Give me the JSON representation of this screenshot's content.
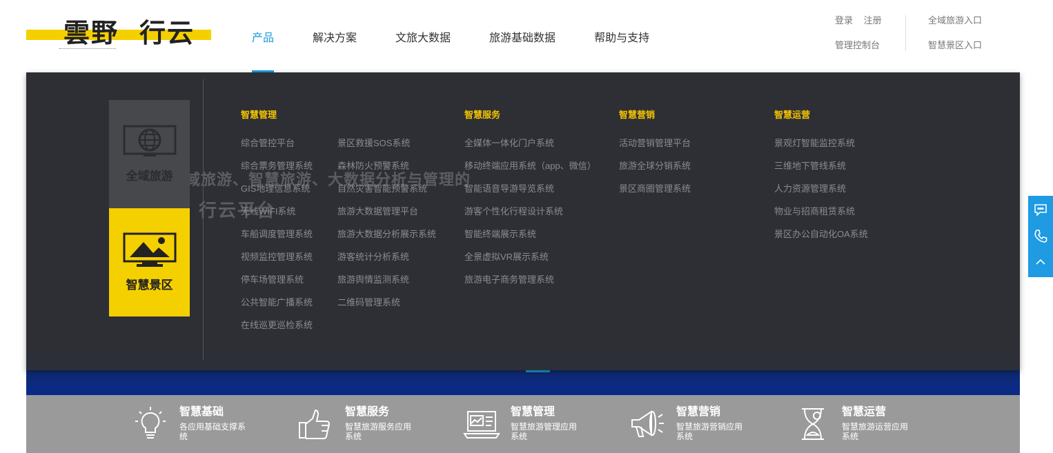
{
  "logo": {
    "char_a": "雲野",
    "char_b": "行云"
  },
  "nav": {
    "items": [
      {
        "label": "产品",
        "active": true
      },
      {
        "label": "解决方案"
      },
      {
        "label": "文旅大数据"
      },
      {
        "label": "旅游基础数据"
      },
      {
        "label": "帮助与支持"
      }
    ]
  },
  "user_links": {
    "login": "登录",
    "register": "注册",
    "console": "管理控制台"
  },
  "entry_links": {
    "region": "全域旅游入口",
    "scenic": "智慧景区入口"
  },
  "banner": {
    "bg_line1": "域旅游、智慧旅游、大数据分析与管理的",
    "bg_line2": "行云平台"
  },
  "side_tabs": [
    {
      "label": "全域旅游",
      "icon": "globe-monitor-icon"
    },
    {
      "label": "智慧景区",
      "icon": "landscape-monitor-icon",
      "active": true
    }
  ],
  "columns": {
    "management": {
      "title": "智慧管理",
      "left": [
        "综合管控平台",
        "综合票务管理系统",
        "GIS地理信息系统",
        "无线WIFI系统",
        "车船调度管理系统",
        "视频监控管理系统",
        "停车场管理系统",
        "公共智能广播系统",
        "在线巡更巡检系统"
      ],
      "right": [
        "景区救援SOS系统",
        "森林防火预警系统",
        "自然灾害智能预警系统",
        "旅游大数据管理平台",
        "旅游大数据分析展示系统",
        "游客统计分析系统",
        "旅游舆情监测系统",
        "二维码管理系统"
      ]
    },
    "service": {
      "title": "智慧服务",
      "items": [
        "全媒体一体化门户系统",
        "移动终端应用系统（app、微信）",
        "智能语音导游导览系统",
        "游客个性化行程设计系统",
        "智能终端展示系统",
        "全景虚拟VR展示系统",
        "旅游电子商务管理系统"
      ]
    },
    "marketing": {
      "title": "智慧营销",
      "items": [
        "活动营销管理平台",
        "旅游全球分销系统",
        "景区商圈管理系统"
      ]
    },
    "operation": {
      "title": "智慧运营",
      "items": [
        "景观灯智能监控系统",
        "三维地下管线系统",
        "人力资源管理系统",
        "物业与招商租赁系统",
        "景区办公自动化OA系统"
      ]
    }
  },
  "features": [
    {
      "title": "智慧基础",
      "desc": "各应用基础支撑系统",
      "icon": "lightbulb-icon"
    },
    {
      "title": "智慧服务",
      "desc": "智慧旅游服务应用系统",
      "icon": "thumbs-up-icon"
    },
    {
      "title": "智慧管理",
      "desc": "智慧旅游管理应用系统",
      "icon": "laptop-chart-icon"
    },
    {
      "title": "智慧营销",
      "desc": "智慧旅游营销应用系统",
      "icon": "megaphone-icon"
    },
    {
      "title": "智慧运营",
      "desc": "智慧旅游运营应用系统",
      "icon": "hourglass-icon"
    }
  ],
  "float_buttons": [
    "chat-icon",
    "phone-icon",
    "scroll-top-icon"
  ],
  "colors": {
    "accent": "#1a9ad6",
    "yellow": "#f5d000",
    "dropdown_bg": "#2e3034",
    "bottom_bg": "#9a9a9a"
  }
}
